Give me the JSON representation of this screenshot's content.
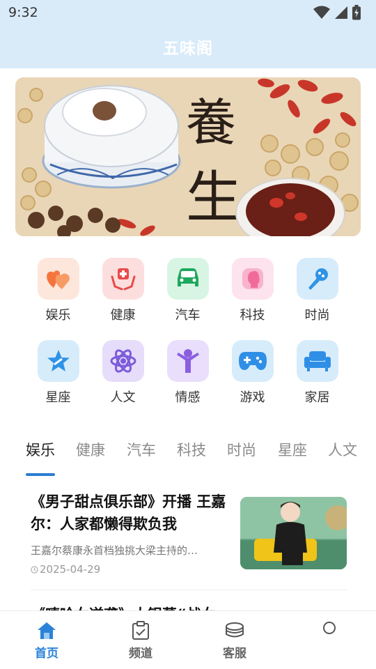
{
  "status_bar": {
    "time": "9:32"
  },
  "header": {
    "title": "五味阁"
  },
  "banner": {
    "calligraphy": [
      "養",
      "生"
    ],
    "slide_count": 2,
    "active_slide": 1
  },
  "categories": [
    {
      "label": "娱乐",
      "icon": "hearts-icon",
      "color": "#f5743e",
      "bg": "#fde6dc"
    },
    {
      "label": "健康",
      "icon": "medical-hands-icon",
      "color": "#e84a4a",
      "bg": "#fddede"
    },
    {
      "label": "汽车",
      "icon": "car-icon",
      "color": "#1fa85e",
      "bg": "#d8f5e4"
    },
    {
      "label": "科技",
      "icon": "face-profile-icon",
      "color": "#f06b9a",
      "bg": "#fde3ee"
    },
    {
      "label": "时尚",
      "icon": "microphone-icon",
      "color": "#2f93e6",
      "bg": "#d7ecfb"
    },
    {
      "label": "星座",
      "icon": "star-icon",
      "color": "#2f93e6",
      "bg": "#d7ecfb"
    },
    {
      "label": "人文",
      "icon": "atom-icon",
      "color": "#7c5ad9",
      "bg": "#e6ddfa"
    },
    {
      "label": "情感",
      "icon": "person-arms-icon",
      "color": "#8b5ee0",
      "bg": "#e9defb"
    },
    {
      "label": "游戏",
      "icon": "gamepad-icon",
      "color": "#2f8fe6",
      "bg": "#d7ecfb"
    },
    {
      "label": "家居",
      "icon": "sofa-icon",
      "color": "#2f8fe6",
      "bg": "#d7ecfb"
    }
  ],
  "tabs": [
    "娱乐",
    "健康",
    "汽车",
    "科技",
    "时尚",
    "星座",
    "人文"
  ],
  "active_tab": "娱乐",
  "articles": [
    {
      "title": "《男子甜点俱乐部》开播 王嘉尔：人家都懒得欺负我",
      "summary": "王嘉尔蔡康永首档独挑大梁主持的…",
      "date": "2025-04-29"
    }
  ],
  "next_article_title": "《嘻哈女逆袭》大银幕“战女…",
  "bottom_nav": [
    {
      "label": "首页",
      "icon": "home-icon",
      "active": true
    },
    {
      "label": "频道",
      "icon": "clipboard-icon",
      "active": false
    },
    {
      "label": "客服",
      "icon": "service-icon",
      "active": false
    },
    {
      "label": "",
      "icon": "profile-icon",
      "active": false
    }
  ],
  "colors": {
    "accent": "#2a83d8",
    "header_bg": "#d9ebf9"
  }
}
